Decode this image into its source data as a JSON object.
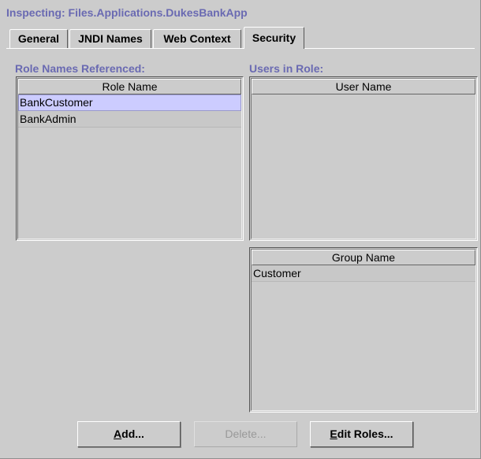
{
  "inspector": {
    "title": "Inspecting: Files.Applications.DukesBankApp"
  },
  "tabs": [
    {
      "label": "General",
      "active": false
    },
    {
      "label": "JNDI Names",
      "active": false
    },
    {
      "label": "Web Context",
      "active": false
    },
    {
      "label": "Security",
      "active": true
    }
  ],
  "roles": {
    "section_label": "Role Names Referenced:",
    "column_header": "Role Name",
    "rows": [
      "BankCustomer",
      "BankAdmin"
    ],
    "selected": "BankCustomer"
  },
  "users": {
    "section_label": "Users in Role:",
    "column_header": "User Name",
    "rows": []
  },
  "groups": {
    "column_header": "Group Name",
    "rows": [
      "Customer"
    ]
  },
  "buttons": {
    "add": {
      "mnemonic": "A",
      "rest": "dd...",
      "enabled": true
    },
    "delete": {
      "label": "Delete...",
      "enabled": false
    },
    "edit_roles": {
      "mnemonic": "E",
      "rest": "dit Roles...",
      "enabled": true
    }
  },
  "colors": {
    "panel_bg": "#cccccc",
    "label_accent": "#6a6ab2",
    "selection": "#ccccff"
  }
}
